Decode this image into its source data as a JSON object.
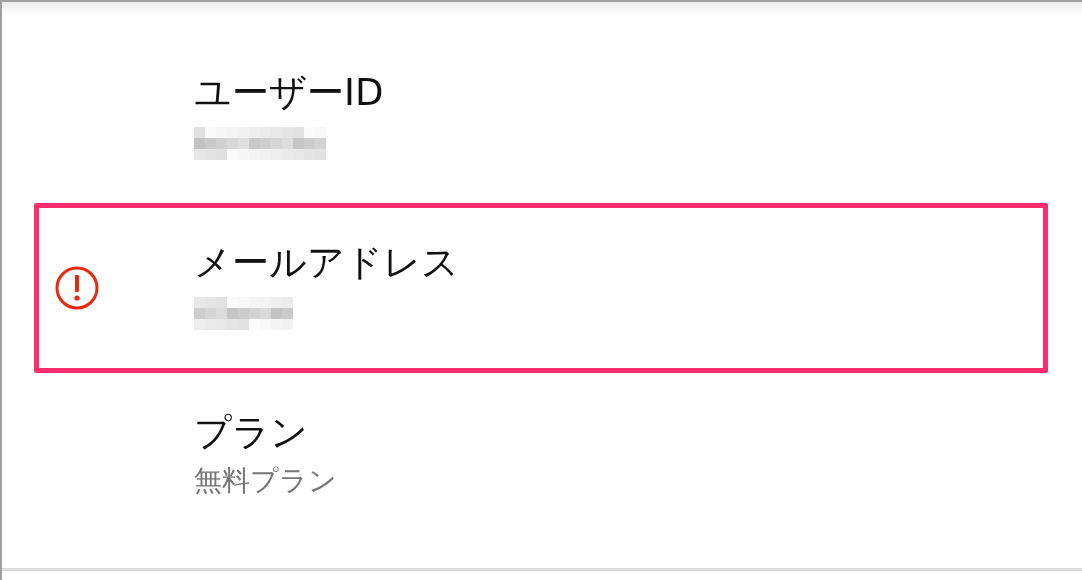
{
  "items": [
    {
      "title": "ユーザーID",
      "kind": "redacted",
      "highlighted": false,
      "warning": false
    },
    {
      "title": "メールアドレス",
      "kind": "redacted",
      "highlighted": true,
      "warning": true
    },
    {
      "title": "プラン",
      "kind": "text",
      "value": "無料プラン",
      "highlighted": false,
      "warning": false
    }
  ]
}
